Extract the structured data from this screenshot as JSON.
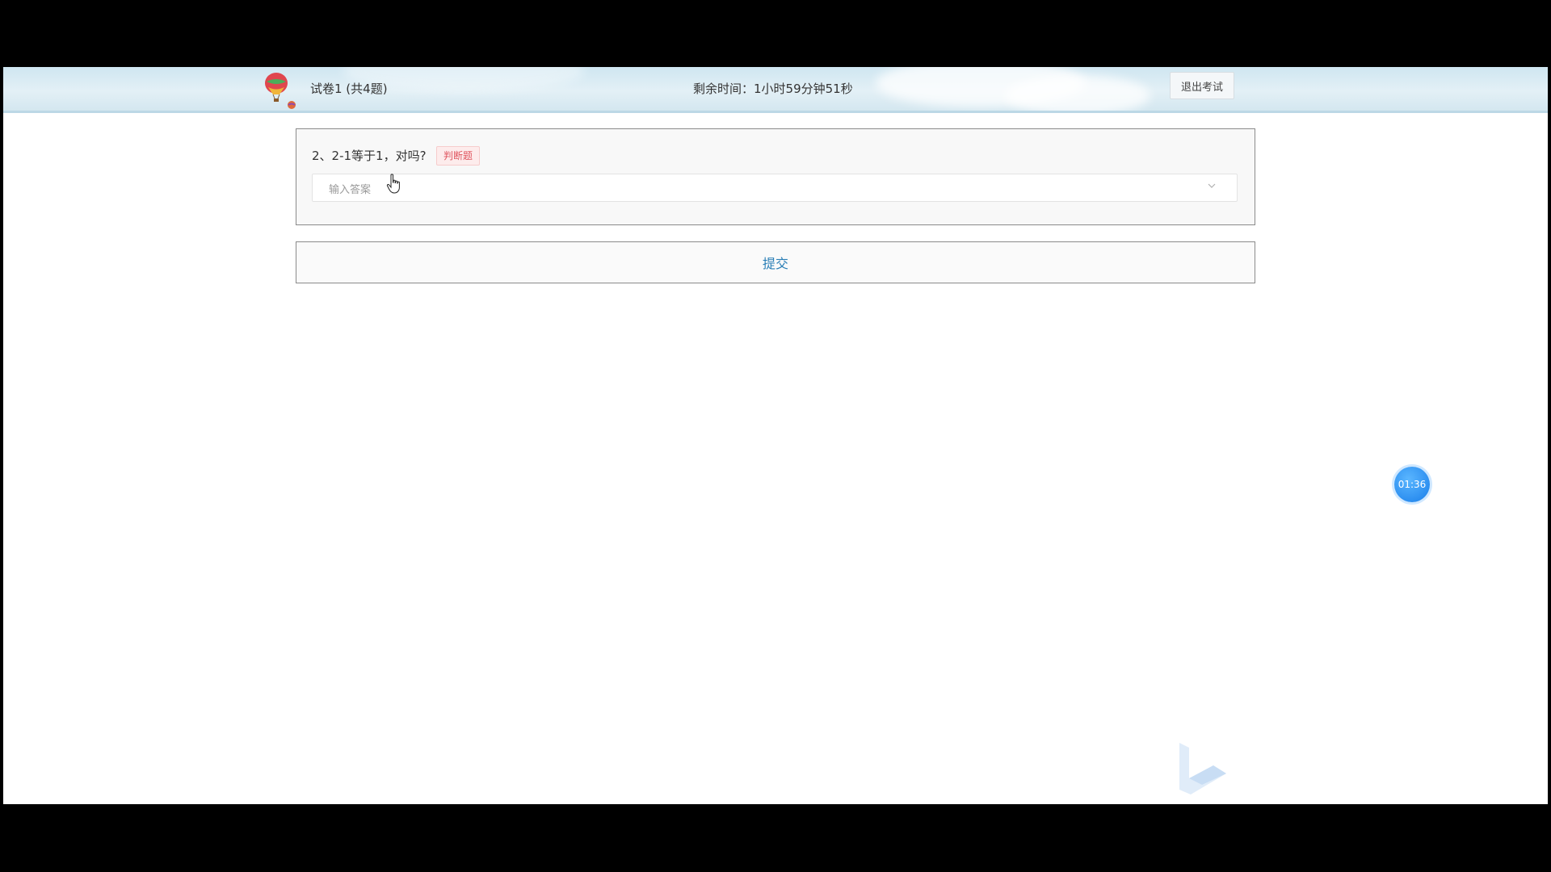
{
  "header": {
    "exam_title": "试卷1 (共4题)",
    "remaining_time": "剩余时间：1小时59分钟51秒",
    "exit_label": "退出考试"
  },
  "question": {
    "text": "2、2-1等于1，对吗?",
    "type_tag": "判断题",
    "answer_placeholder": "输入答案"
  },
  "submit_label": "提交",
  "floating_timer": "01:36",
  "colors": {
    "accent_blue": "#2d8ff0",
    "submit_text": "#2b7fb6",
    "tag_red": "#e0555f"
  }
}
